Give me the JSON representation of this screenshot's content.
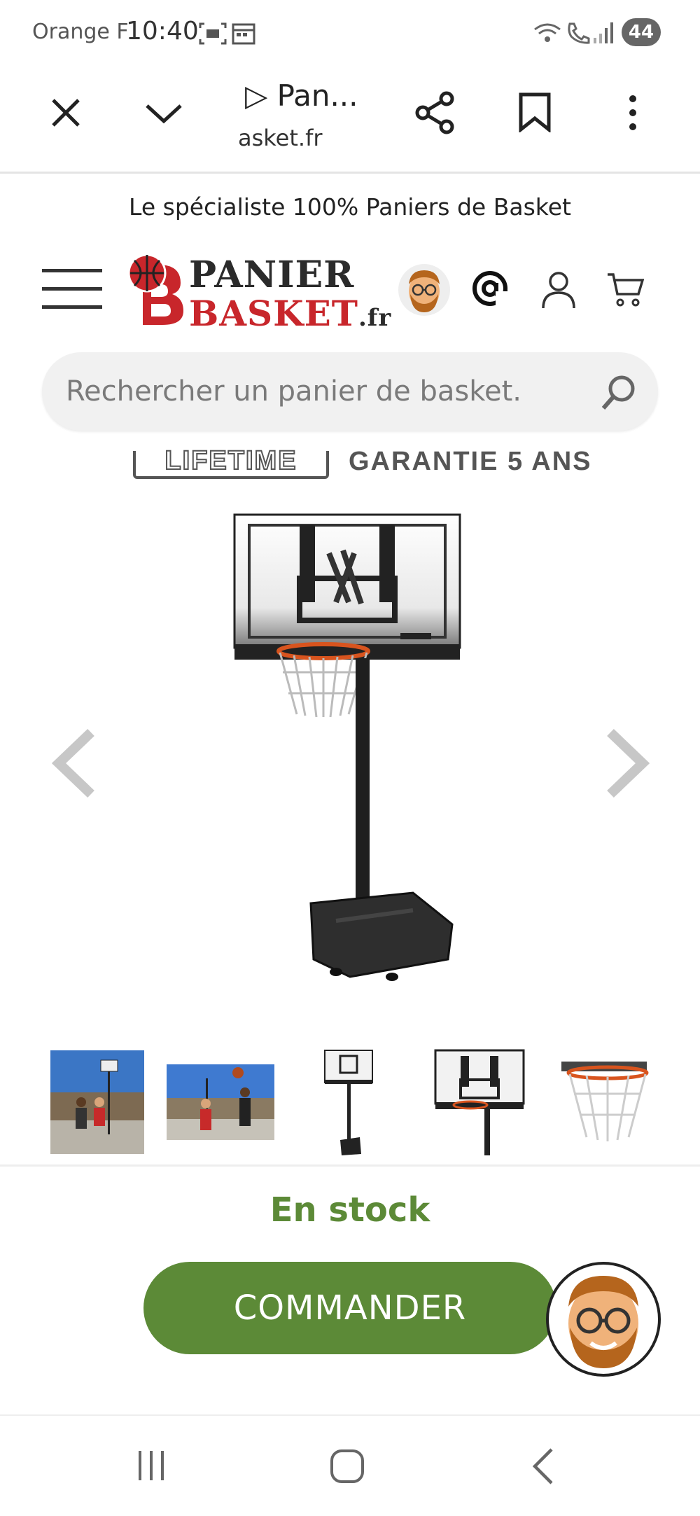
{
  "status_bar": {
    "carrier": "Orange F",
    "time": "10:40",
    "battery": "44"
  },
  "browser": {
    "tab_title": "▷ Pan...",
    "url": "asket.fr"
  },
  "site": {
    "tagline": "Le spécialiste 100% Paniers de Basket",
    "logo_line1": "PANIER",
    "logo_line2": "BASKET",
    "logo_tld": ".fr",
    "search_placeholder": "Rechercher un panier de basket."
  },
  "product": {
    "banner_left": "LIFETIME",
    "banner_right": "GARANTIE 5 ANS",
    "stock_status": "En stock",
    "order_label": "COMMANDER"
  },
  "colors": {
    "accent_green": "#5c8a37",
    "brand_red": "#c8262b"
  },
  "icons": {
    "close": "close-icon",
    "dropdown": "chevron-down-icon",
    "share": "share-icon",
    "bookmark": "bookmark-icon",
    "menu": "more-vert-icon"
  }
}
